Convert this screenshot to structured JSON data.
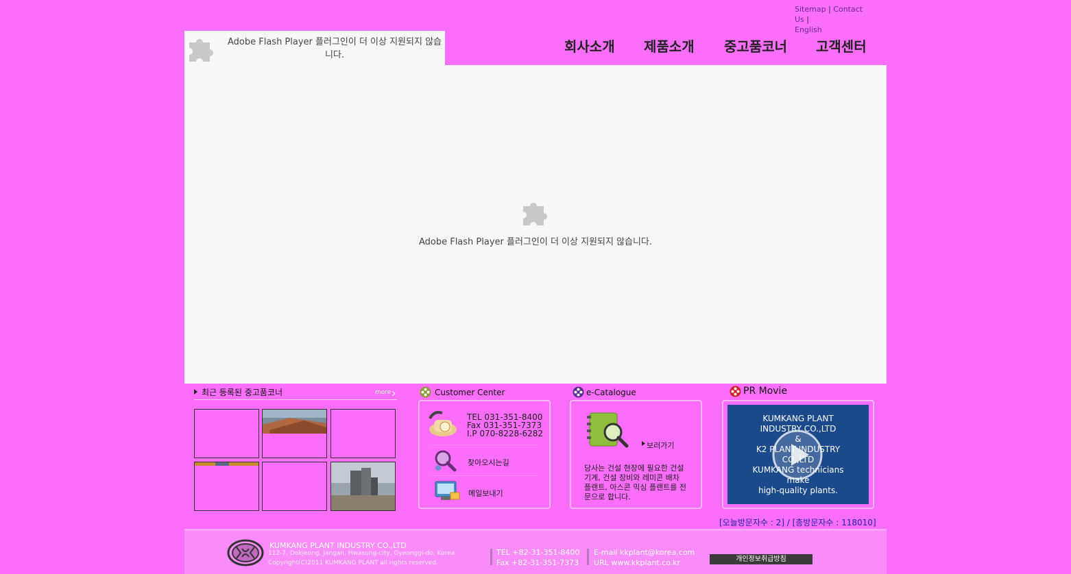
{
  "util_links": {
    "sitemap": "Sitemap",
    "contact": "Contact Us",
    "english": "English",
    "separator": "|"
  },
  "flash_logo": {
    "message": "Adobe Flash Player 플러그인이 더 이상 지원되지 않습니다."
  },
  "nav": {
    "items": [
      "회사소개",
      "제품소개",
      "중고품코너",
      "고객센터"
    ]
  },
  "main_flash": {
    "message": "Adobe Flash Player 플러그인이 더 이상 지원되지 않습니다."
  },
  "used_corner": {
    "title": "최근 등록된 중고품코너",
    "more": "more"
  },
  "customer_center": {
    "title": "Customer Center",
    "tel": "TEL  031-351-8400",
    "fax": "Fax  031-351-7373",
    "ip": "I.P   070-8228-6282",
    "directions": "찾아오시는길",
    "send_mail": "메일보내기"
  },
  "catalogue": {
    "title": "e-Catalogue",
    "view": "보러가기",
    "description": "당사는 건설 현장에 필요한 건설 기계, 건설 장비와 레미콘 배차 플랜트, 아스콘 믹싱 플랜트를 전문으로 합니다."
  },
  "pr_movie": {
    "title": "PR Movie",
    "line1": "KUMKANG PLANT",
    "line2": "INDUSTRY CO.,LTD",
    "line3": "&",
    "line4": "K2 PLANT INDUSTRY",
    "line5": "CO.,LTD",
    "line6": "KUMKANG technicians",
    "line7": "make",
    "line8": "high-quality plants."
  },
  "visitors": {
    "text": "[오늘방문자수 : 2] / [총방문자수 : 118010]"
  },
  "footer": {
    "company": "KUMKANG PLANT INDUSTRY CO.,LTD",
    "address": "112-7, Dokjeong, Jangan, Hwasung-city, Gyeonggi-do, Korea",
    "copyright": "Copyright(C)2011 KUMKANG PLANT all rights reserved.",
    "tel": "TEL +82-31-351-8400",
    "fax": "Fax +82-31-351-7373",
    "email": "E-mail kkplant@korea.com",
    "url": "URL     www.kkplant.co.kr",
    "privacy": "개인정보취급방침"
  },
  "colors": {
    "background": "#fb6efb",
    "flash_bg": "#f7f7f7",
    "movie_bg": "#1b4a8c",
    "footer_bg": "#f98cf9"
  }
}
